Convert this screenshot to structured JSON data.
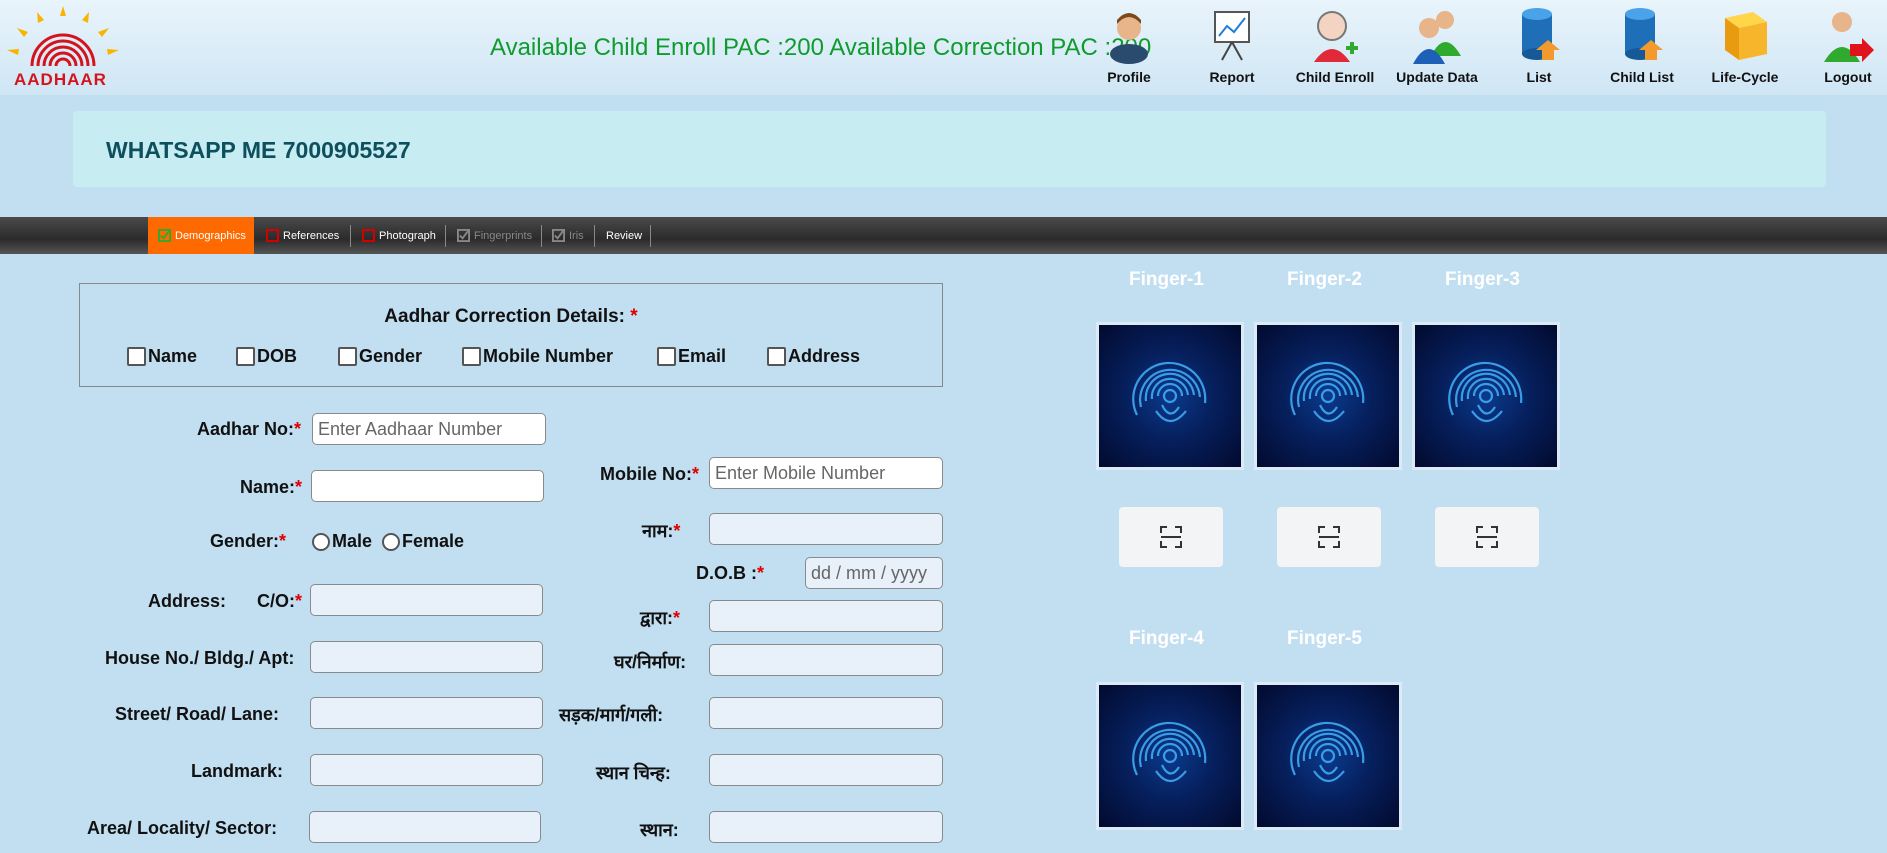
{
  "header": {
    "logo_text": "AADHAAR",
    "pac_text": "Available Child Enroll PAC :200 Available Correction PAC :200",
    "nav": [
      {
        "label": "Profile",
        "icon": "profile-icon"
      },
      {
        "label": "Report",
        "icon": "report-icon"
      },
      {
        "label": "Child Enroll",
        "icon": "child-enroll-icon"
      },
      {
        "label": "Update Data",
        "icon": "update-data-icon"
      },
      {
        "label": "List",
        "icon": "list-icon"
      },
      {
        "label": "Child List",
        "icon": "child-list-icon"
      },
      {
        "label": "Life-Cycle",
        "icon": "life-cycle-icon"
      },
      {
        "label": "Logout",
        "icon": "logout-icon"
      }
    ]
  },
  "banner": {
    "text": "WHATSAPP ME 7000905527"
  },
  "tabs": [
    {
      "label": "Demographics",
      "state": "active"
    },
    {
      "label": "References",
      "state": "pending"
    },
    {
      "label": "Photograph",
      "state": "pending"
    },
    {
      "label": "Fingerprints",
      "state": "disabled"
    },
    {
      "label": "Iris",
      "state": "disabled"
    },
    {
      "label": "Review",
      "state": "normal"
    }
  ],
  "correction": {
    "title": "Aadhar Correction Details:",
    "required_mark": "*",
    "options": [
      "Name",
      "DOB",
      "Gender",
      "Mobile Number",
      "Email",
      "Address"
    ]
  },
  "form": {
    "aadhar_label": "Aadhar No:",
    "aadhar_placeholder": "Enter Aadhaar Number",
    "name_label": "Name:",
    "gender_label": "Gender:",
    "gender_options": [
      "Male",
      "Female"
    ],
    "address_label": "Address:",
    "co_label": "C/O:",
    "house_label": "House No./ Bldg./ Apt:",
    "street_label": "Street/ Road/ Lane:",
    "landmark_label": "Landmark:",
    "area_label": "Area/ Locality/ Sector:",
    "mobile_label": "Mobile No:",
    "mobile_placeholder": "Enter Mobile Number",
    "naam_label": "नाम:",
    "dob_label": "D.O.B :",
    "dob_placeholder": "dd / mm / yyyy",
    "dwara_label": "द्वारा:",
    "ghar_label": "घर/निर्माण:",
    "sadak_label": "सड़क/मार्ग/गली:",
    "sthan_chinh_label": "स्थान चिन्ह:",
    "sthan_label": "स्थान:",
    "required_mark": "*"
  },
  "fingers": {
    "labels": [
      "Finger-1",
      "Finger-2",
      "Finger-3",
      "Finger-4",
      "Finger-5"
    ]
  },
  "colors": {
    "page_bg": "#c2dff2",
    "pac_text": "#0f9b2e",
    "banner_bg": "#c7ecf1",
    "banner_text": "#0e4f5d",
    "active_tab": "#ff6a00",
    "required": "#e00000"
  }
}
